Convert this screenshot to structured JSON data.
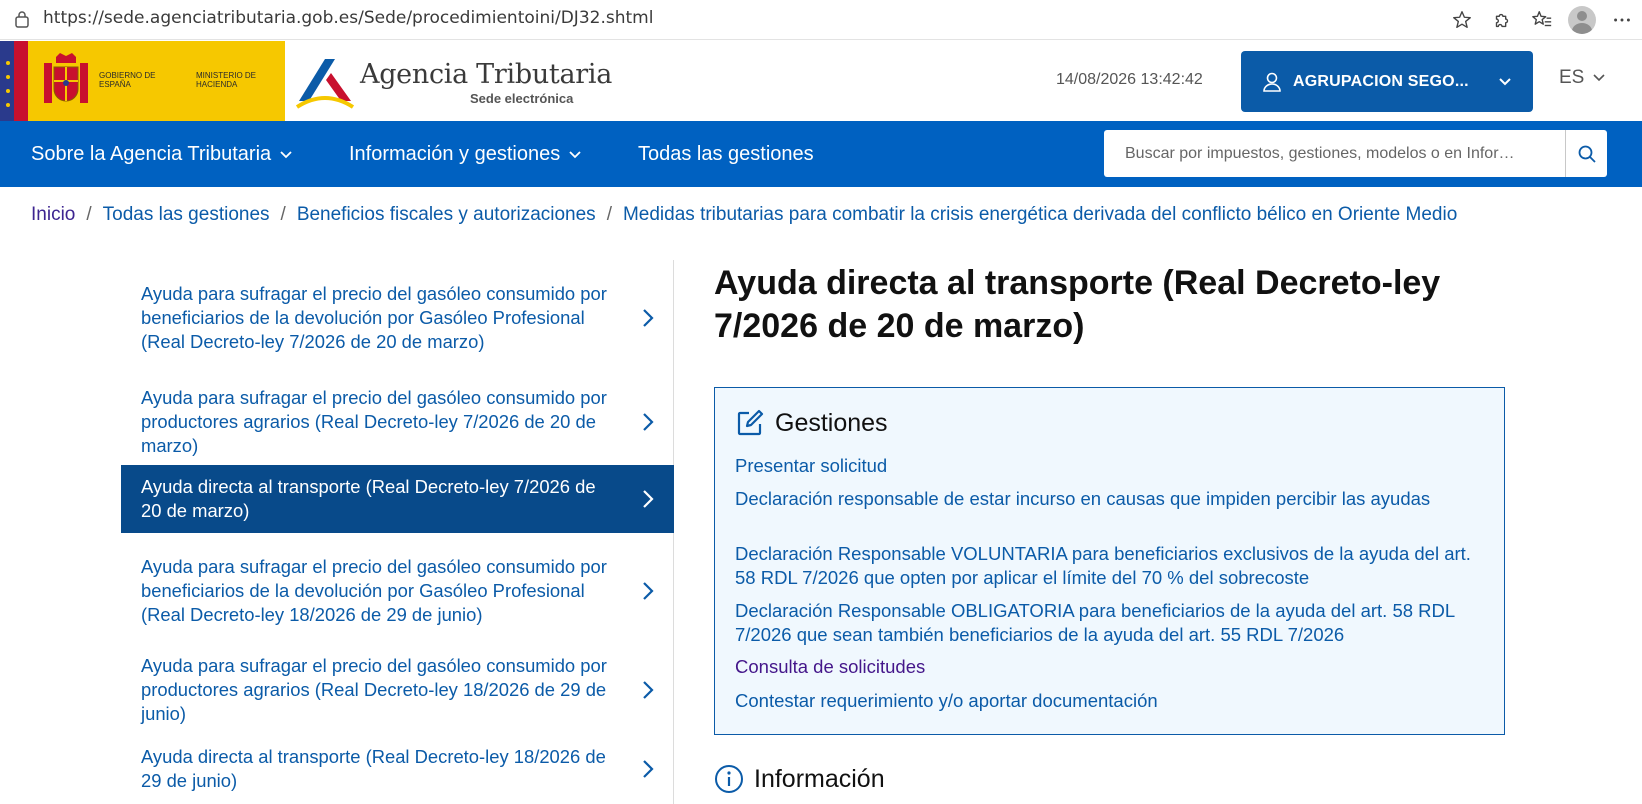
{
  "browser": {
    "url": "https://sede.agenciatributaria.gob.es/Sede/procedimientoini/DJ32.shtml"
  },
  "header": {
    "gov_line1": "Gobierno de España",
    "gov_line2": "Ministerio de Hacienda",
    "agency_name": "Agencia Tributaria",
    "agency_sub": "Sede electrónica",
    "datetime": "14/08/2026 13:42:42",
    "user_name": "AGRUPACION SEGO...",
    "language": "ES"
  },
  "nav": {
    "items": [
      {
        "label": "Sobre la Agencia Tributaria"
      },
      {
        "label": "Información y gestiones"
      },
      {
        "label": "Todas las gestiones"
      }
    ],
    "search_placeholder": "Buscar por impuestos, gestiones, modelos o en Infor…"
  },
  "breadcrumb": [
    "Inicio",
    "Todas las gestiones",
    "Beneficios fiscales y autorizaciones",
    "Medidas tributarias para combatir la crisis energética derivada del conflicto bélico en Oriente Medio"
  ],
  "sidebar": {
    "items": [
      {
        "label": "Ayuda para sufragar el precio del gasóleo consumido por beneficiarios de la devolución por Gasóleo Profesional (Real Decreto-ley 7/2026 de 20 de marzo)"
      },
      {
        "label": "Ayuda para sufragar el precio del gasóleo consumido por productores agrarios (Real Decreto-ley 7/2026 de 20 de marzo)"
      },
      {
        "label": "Ayuda directa al transporte (Real Decreto-ley 7/2026 de 20 de marzo)"
      },
      {
        "label": "Ayuda para sufragar el precio del gasóleo consumido por beneficiarios de la devolución por Gasóleo Profesional (Real Decreto-ley 18/2026 de 29 de junio)"
      },
      {
        "label": "Ayuda para sufragar el precio del gasóleo consumido por productores agrarios (Real Decreto-ley 18/2026 de 29 de junio)"
      },
      {
        "label": "Ayuda directa al transporte (Real Decreto-ley 18/2026 de 29 de junio)"
      }
    ]
  },
  "main": {
    "title": "Ayuda directa al transporte (Real Decreto-ley 7/2026 de 20 de marzo)",
    "gestiones": {
      "heading": "Gestiones",
      "links": [
        "Presentar solicitud",
        "Declaración responsable de estar incurso en causas que impiden percibir las ayudas",
        "Declaración Responsable VOLUNTARIA para beneficiarios exclusivos de la ayuda del art. 58 RDL 7/2026 que opten por aplicar el límite del 70 % del sobrecoste",
        "Declaración Responsable OBLIGATORIA para beneficiarios de la ayuda del art. 58 RDL 7/2026 que sean también beneficiarios de la ayuda del art. 55 RDL 7/2026",
        "Consulta de solicitudes",
        "Contestar requerimiento y/o aportar documentación"
      ]
    },
    "informacion_heading": "Información"
  },
  "colors": {
    "brand_blue": "#0061c1",
    "link_blue": "#0b5ba8",
    "active_sidebar": "#084a8a",
    "visited_link": "#44168a",
    "gov_yellow": "#f6c800"
  }
}
